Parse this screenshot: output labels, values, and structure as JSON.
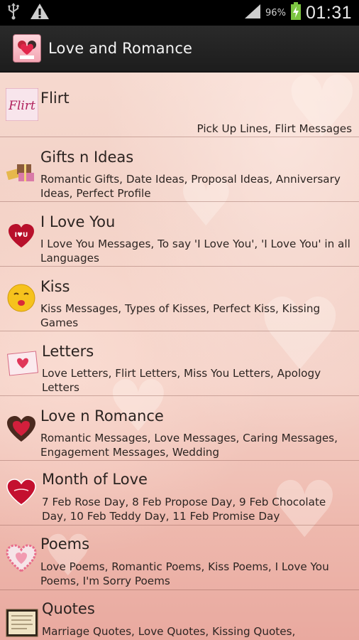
{
  "status_bar": {
    "battery_percent": "96%",
    "time": "01:31",
    "icons": [
      "usb-icon",
      "warning-icon",
      "signal-icon",
      "battery-icon"
    ]
  },
  "action_bar": {
    "title": "Love and Romance",
    "app_icon": "love-app-icon"
  },
  "colors": {
    "status_bar_bg": "#000000",
    "action_bar_bg": "#222222",
    "battery_green": "#7cc641",
    "text": "#2b2320"
  },
  "categories": [
    {
      "title": "Flirt",
      "description": "Pick Up Lines, Flirt Messages",
      "icon": "flirt-icon"
    },
    {
      "title": "Gifts n Ideas",
      "description": "Romantic Gifts, Date Ideas, Proposal Ideas, Anniversary Ideas, Perfect Profile",
      "icon": "gift-boxes-icon"
    },
    {
      "title": "I Love You",
      "description": "I Love You Messages, To say 'I Love You', 'I Love You' in all Languages",
      "icon": "i-love-u-heart-icon"
    },
    {
      "title": "Kiss",
      "description": "Kiss Messages, Types of Kisses, Perfect Kiss, Kissing Games",
      "icon": "kiss-smiley-icon"
    },
    {
      "title": "Letters",
      "description": "Love Letters, Flirt Letters, Miss You Letters, Apology Letters",
      "icon": "love-letter-icon"
    },
    {
      "title": "Love n Romance",
      "description": "Romantic Messages, Love Messages, Caring Messages, Engagement Messages, Wedding",
      "icon": "chocolate-heart-icon"
    },
    {
      "title": "Month of Love",
      "description": "7 Feb Rose Day, 8 Feb Propose Day, 9 Feb Chocolate Day, 10 Feb Teddy Day, 11 Feb Promise Day",
      "icon": "valentines-day-heart-icon"
    },
    {
      "title": "Poems",
      "description": "Love Poems, Romantic Poems, Kiss Poems, I Love You Poems, I'm Sorry Poems",
      "icon": "poem-heart-icon"
    },
    {
      "title": "Quotes",
      "description": "Marriage Quotes, Love Quotes, Kissing Quotes,",
      "icon": "quote-card-icon"
    }
  ]
}
